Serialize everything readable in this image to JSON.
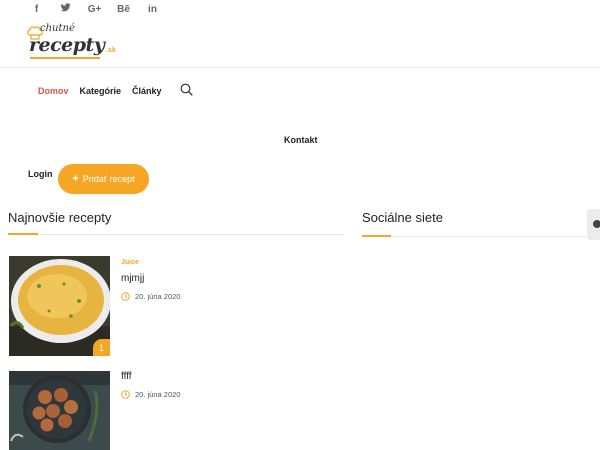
{
  "social": [
    {
      "icon": "facebook-icon",
      "glyph": "f"
    },
    {
      "icon": "twitter-icon",
      "glyph": "❧"
    },
    {
      "icon": "google-plus-icon",
      "glyph": "G+"
    },
    {
      "icon": "behance-icon",
      "glyph": "Bē"
    },
    {
      "icon": "linkedin-icon",
      "glyph": "in"
    }
  ],
  "logo": {
    "line1": "chutné",
    "line2": "recepty",
    "suffix": ".sk"
  },
  "nav": {
    "home": "Domov",
    "categories": "Kategórie",
    "articles": "Články",
    "contact": "Kontakt"
  },
  "auth": {
    "login": "Login",
    "add_recipe": "Pridať recept",
    "add_icon": "+"
  },
  "sections": {
    "latest": "Najnovšie recepty",
    "social": "Sociálne siete"
  },
  "recipes": [
    {
      "category": "Juice",
      "title": "mjmjj",
      "date": "20. júna 2020",
      "badge": "1"
    },
    {
      "category": "",
      "title": "ffff",
      "date": "20. júna 2020",
      "badge": ""
    }
  ],
  "colors": {
    "accent": "#f5a623",
    "active_nav": "#e0534a"
  }
}
